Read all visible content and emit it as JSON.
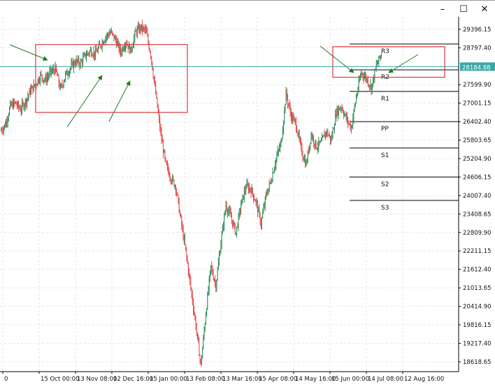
{
  "window": {
    "minimize_icon": "minimize-icon",
    "maximize_icon": "maximize-icon",
    "close_icon": "close-icon",
    "minimize_glyph": "–",
    "maximize_glyph": "☐",
    "close_glyph": "✕"
  },
  "colors": {
    "bull": "#2e8b57",
    "bear": "#e24a4a",
    "grid": "#e6e6e6",
    "price_line": "#3aa7a7",
    "price_tag_bg": "#3aa7a7",
    "box": "#d93a3a",
    "arrow": "#1f7a1f",
    "pivot_line": "#000000"
  },
  "chart_data": {
    "type": "candlestick",
    "title": "",
    "xlabel": "",
    "ylabel": "",
    "grid": true,
    "ylim": [
      18300,
      29800
    ],
    "y_ticks": [
      "29396.15",
      "28797.40",
      "28184.88",
      "27599.90",
      "27001.15",
      "26402.40",
      "25803.65",
      "25204.90",
      "24606.15",
      "24007.40",
      "23408.65",
      "22809.90",
      "22211.15",
      "21612.40",
      "21013.65",
      "20414.90",
      "19816.15",
      "19217.40",
      "18618.65"
    ],
    "y_tick_values": [
      29396.15,
      28797.4,
      28198.65,
      27599.9,
      27001.15,
      26402.4,
      25803.65,
      25204.9,
      24606.15,
      24007.4,
      23408.65,
      22809.9,
      22211.15,
      21612.4,
      21013.65,
      20414.9,
      19816.15,
      19217.4,
      18618.65
    ],
    "x_ticks": [
      "0",
      "15 Oct 00:00",
      "13 Nov 08:00",
      "12 Dec 16:00",
      "15 Jan 00:00",
      "13 Feb 08:00",
      "13 Mar 16:00",
      "15 Apr 08:00",
      "14 May 16:00",
      "15 Jun 00:00",
      "14 Jul 08:00",
      "12 Aug 16:00"
    ],
    "current_price": 28184.88,
    "current_price_label": "28184.88",
    "pivots": [
      {
        "name": "R3",
        "value": 28916.0
      },
      {
        "name": "R2",
        "value": 28079.0
      },
      {
        "name": "R1",
        "value": 27380.0
      },
      {
        "name": "PP",
        "value": 26402.4
      },
      {
        "name": "S1",
        "value": 25547.0
      },
      {
        "name": "S2",
        "value": 24606.15
      },
      {
        "name": "S3",
        "value": 23850.0
      }
    ],
    "price_path": [
      [
        0,
        26100
      ],
      [
        1,
        26300
      ],
      [
        2,
        26900
      ],
      [
        3,
        27000
      ],
      [
        4,
        26800
      ],
      [
        5,
        27050
      ],
      [
        6,
        27400
      ],
      [
        7,
        27600
      ],
      [
        8,
        27900
      ],
      [
        9,
        27750
      ],
      [
        10,
        28000
      ],
      [
        11,
        28100
      ],
      [
        12,
        27450
      ],
      [
        13,
        27900
      ],
      [
        14,
        28150
      ],
      [
        15,
        28350
      ],
      [
        16,
        28300
      ],
      [
        17,
        28550
      ],
      [
        18,
        28700
      ],
      [
        19,
        28600
      ],
      [
        20,
        28900
      ],
      [
        21,
        29150
      ],
      [
        22,
        29300
      ],
      [
        23,
        29050
      ],
      [
        24,
        28650
      ],
      [
        25,
        29000
      ],
      [
        26,
        28700
      ],
      [
        27,
        29300
      ],
      [
        28,
        29450
      ],
      [
        29,
        29350
      ],
      [
        30,
        28600
      ],
      [
        31,
        27300
      ],
      [
        32,
        26000
      ],
      [
        33,
        25000
      ],
      [
        34,
        24600
      ],
      [
        35,
        24300
      ],
      [
        36,
        23200
      ],
      [
        37,
        22200
      ],
      [
        38,
        21000
      ],
      [
        39,
        19800
      ],
      [
        40,
        18500
      ],
      [
        41,
        20200
      ],
      [
        42,
        21700
      ],
      [
        43,
        21100
      ],
      [
        44,
        22500
      ],
      [
        45,
        23700
      ],
      [
        46,
        23300
      ],
      [
        47,
        22800
      ],
      [
        48,
        23700
      ],
      [
        49,
        24300
      ],
      [
        50,
        24200
      ],
      [
        51,
        23800
      ],
      [
        52,
        23100
      ],
      [
        53,
        24000
      ],
      [
        54,
        24500
      ],
      [
        55,
        25200
      ],
      [
        56,
        25700
      ],
      [
        57,
        27300
      ],
      [
        58,
        26600
      ],
      [
        59,
        26300
      ],
      [
        60,
        25500
      ],
      [
        61,
        25000
      ],
      [
        62,
        26000
      ],
      [
        63,
        25600
      ],
      [
        64,
        25700
      ],
      [
        65,
        26100
      ],
      [
        66,
        25800
      ],
      [
        67,
        26700
      ],
      [
        68,
        26900
      ],
      [
        69,
        26500
      ],
      [
        70,
        26200
      ],
      [
        71,
        27200
      ],
      [
        72,
        28000
      ],
      [
        73,
        27800
      ],
      [
        74,
        27500
      ],
      [
        75,
        28200
      ],
      [
        76,
        28600
      ]
    ]
  },
  "annotations": {
    "boxes": [
      {
        "name": "resistance-zone-left",
        "p_top": 28900,
        "p_bottom": 26700,
        "i_start": 10,
        "i_end": 31
      },
      {
        "name": "resistance-zone-right",
        "p_top": 28830,
        "p_bottom": 27840,
        "i_start": 70,
        "i_end": 81
      }
    ]
  }
}
